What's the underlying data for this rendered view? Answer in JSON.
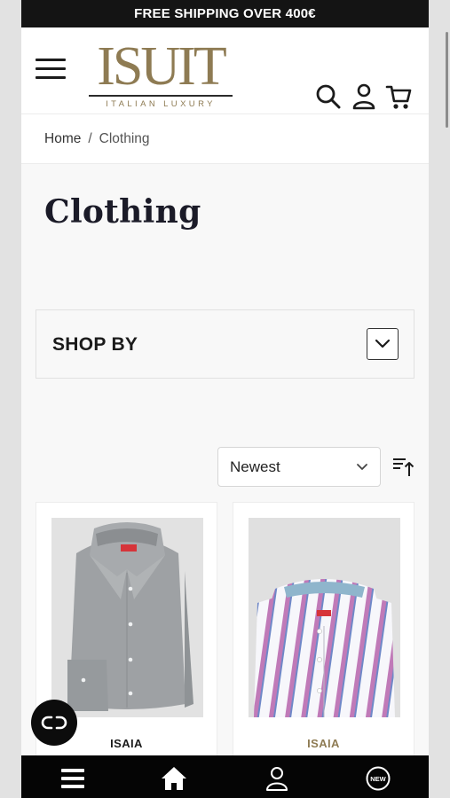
{
  "promo": {
    "text": "FREE SHIPPING OVER 400€"
  },
  "header": {
    "logo_main": "ISUIT",
    "logo_sub": "ITALIAN LUXURY"
  },
  "breadcrumb": {
    "home": "Home",
    "separator": "/",
    "current": "Clothing"
  },
  "page": {
    "title": "Clothing"
  },
  "shop_by": {
    "label": "SHOP BY"
  },
  "sort": {
    "selected": "Newest"
  },
  "products": [
    {
      "brand": "ISAIA",
      "brand_color": "#1b1b1b"
    },
    {
      "brand": "ISAIA",
      "brand_color": "#8e7b53"
    }
  ],
  "colors": {
    "accent_gold": "#8e7b53",
    "dark": "#141414",
    "page_bg": "#f8f8f8"
  },
  "icons": [
    "menu-icon",
    "search-icon",
    "account-icon",
    "cart-icon",
    "chevron-down-icon",
    "sort-direction-icon",
    "chat-icon",
    "home-icon",
    "user-icon",
    "new-badge-icon"
  ]
}
